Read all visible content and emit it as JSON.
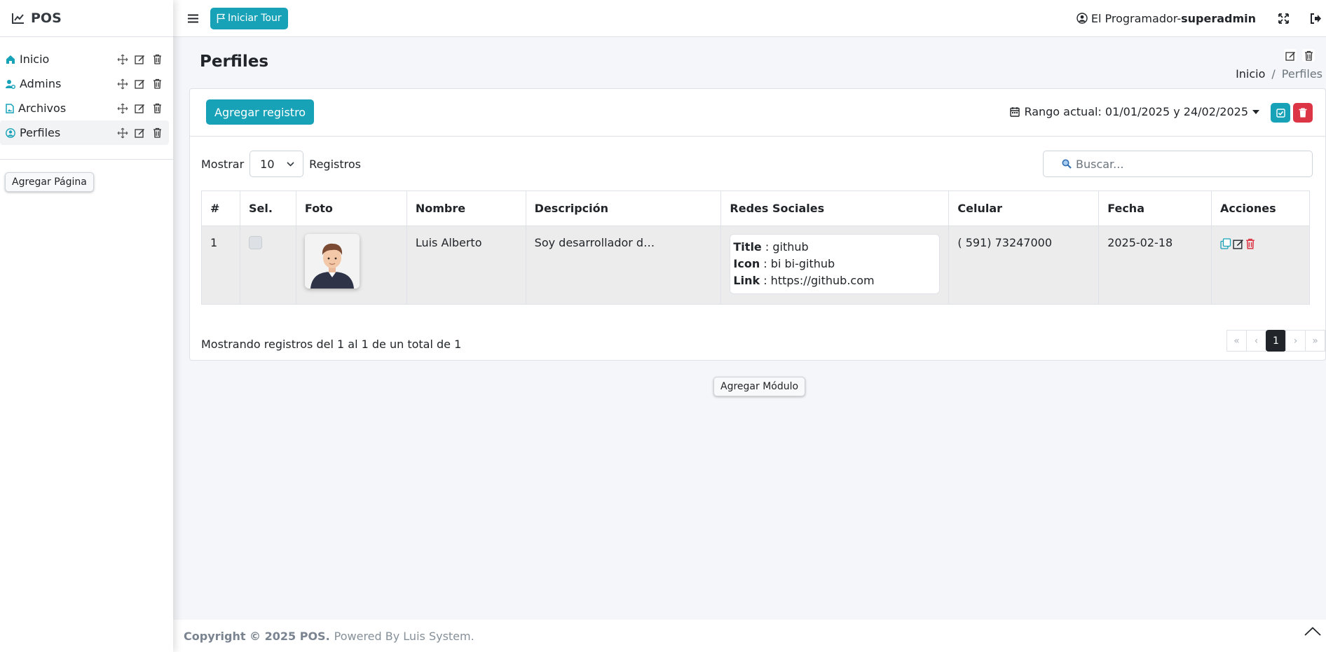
{
  "brand": {
    "name": "POS"
  },
  "sidebar": {
    "items": [
      {
        "label": "Inicio",
        "icon": "home-icon"
      },
      {
        "label": "Admins",
        "icon": "user-gear-icon"
      },
      {
        "label": "Archivos",
        "icon": "file-image-icon"
      },
      {
        "label": "Perfiles",
        "icon": "person-circle-icon"
      }
    ],
    "add_page_label": "Agregar Página"
  },
  "topbar": {
    "tour_label": "Iniciar Tour",
    "user_name": "El Programador-",
    "user_role": "superadmin"
  },
  "page": {
    "title": "Perfiles",
    "breadcrumb": [
      "Inicio",
      "/",
      "Perfiles"
    ]
  },
  "card": {
    "add_record_label": "Agregar registro",
    "range_text": "Rango actual: 01/01/2025 y 24/02/2025",
    "show_label": "Mostrar",
    "page_size": "10",
    "records_label": "Registros",
    "search_placeholder": "Buscar...",
    "info_text": "Mostrando registros del 1 al 1 de un total de 1",
    "current_page": "1"
  },
  "table": {
    "columns": [
      "#",
      "Sel.",
      "Foto",
      "Nombre",
      "Descripción",
      "Redes Sociales",
      "Celular",
      "Fecha",
      "Acciones"
    ],
    "rows": [
      {
        "num": "1",
        "nombre": "Luis Alberto",
        "descripcion": "Soy desarrollador d…",
        "social_title_key": "Title",
        "social_title_val": " : github",
        "social_icon_key": "Icon",
        "social_icon_val": " : bi bi-github",
        "social_link_key": "Link",
        "social_link_val": " : https://github.com",
        "celular": "( 591) 73247000",
        "fecha": "2025-02-18"
      }
    ]
  },
  "add_module_label": "Agregar Módulo",
  "footer": {
    "copyright": "Copyright © 2025 POS.",
    "powered": "Powered By Luis System."
  },
  "colors": {
    "accent": "#17a2b8",
    "danger": "#dc3545",
    "dark": "#212529"
  }
}
